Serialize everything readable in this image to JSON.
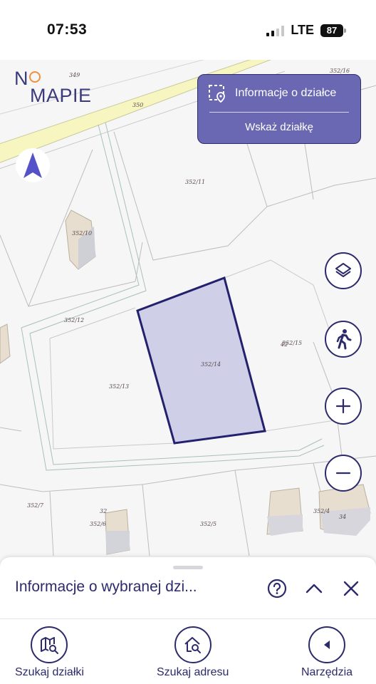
{
  "status_bar": {
    "time": "07:53",
    "network": "LTE",
    "battery": "87"
  },
  "logo": {
    "line1": "N",
    "line2": "MAPIE"
  },
  "info_panel": {
    "title": "Informacje o działce",
    "button_label": "Wskaż działkę"
  },
  "map": {
    "parcels": [
      "349",
      "350",
      "352/16",
      "352/11",
      "352/10",
      "352/12",
      "352/15",
      "352/14",
      "352/13",
      "352/7",
      "352/6",
      "352/5",
      "352/4"
    ],
    "building_numbers": [
      "32",
      "34",
      "42"
    ],
    "highlight_color": "#cfcfe8",
    "highlight_stroke": "#23216e"
  },
  "map_controls": {
    "layers": "layers-icon",
    "street_view": "walking-person-icon",
    "zoom_in": "plus-icon",
    "zoom_out": "minus-icon"
  },
  "bottom_sheet": {
    "title": "Informacje o wybranej dzi..."
  },
  "nav": {
    "items": [
      {
        "label": "Szukaj działki",
        "icon": "map-search-icon"
      },
      {
        "label": "Szukaj adresu",
        "icon": "home-search-icon"
      },
      {
        "label": "Narzędzia",
        "icon": "chevron-left-icon"
      }
    ]
  },
  "colors": {
    "primary": "#2c2a6b",
    "panel": "#6b68b3",
    "accent": "#f28f3b"
  }
}
